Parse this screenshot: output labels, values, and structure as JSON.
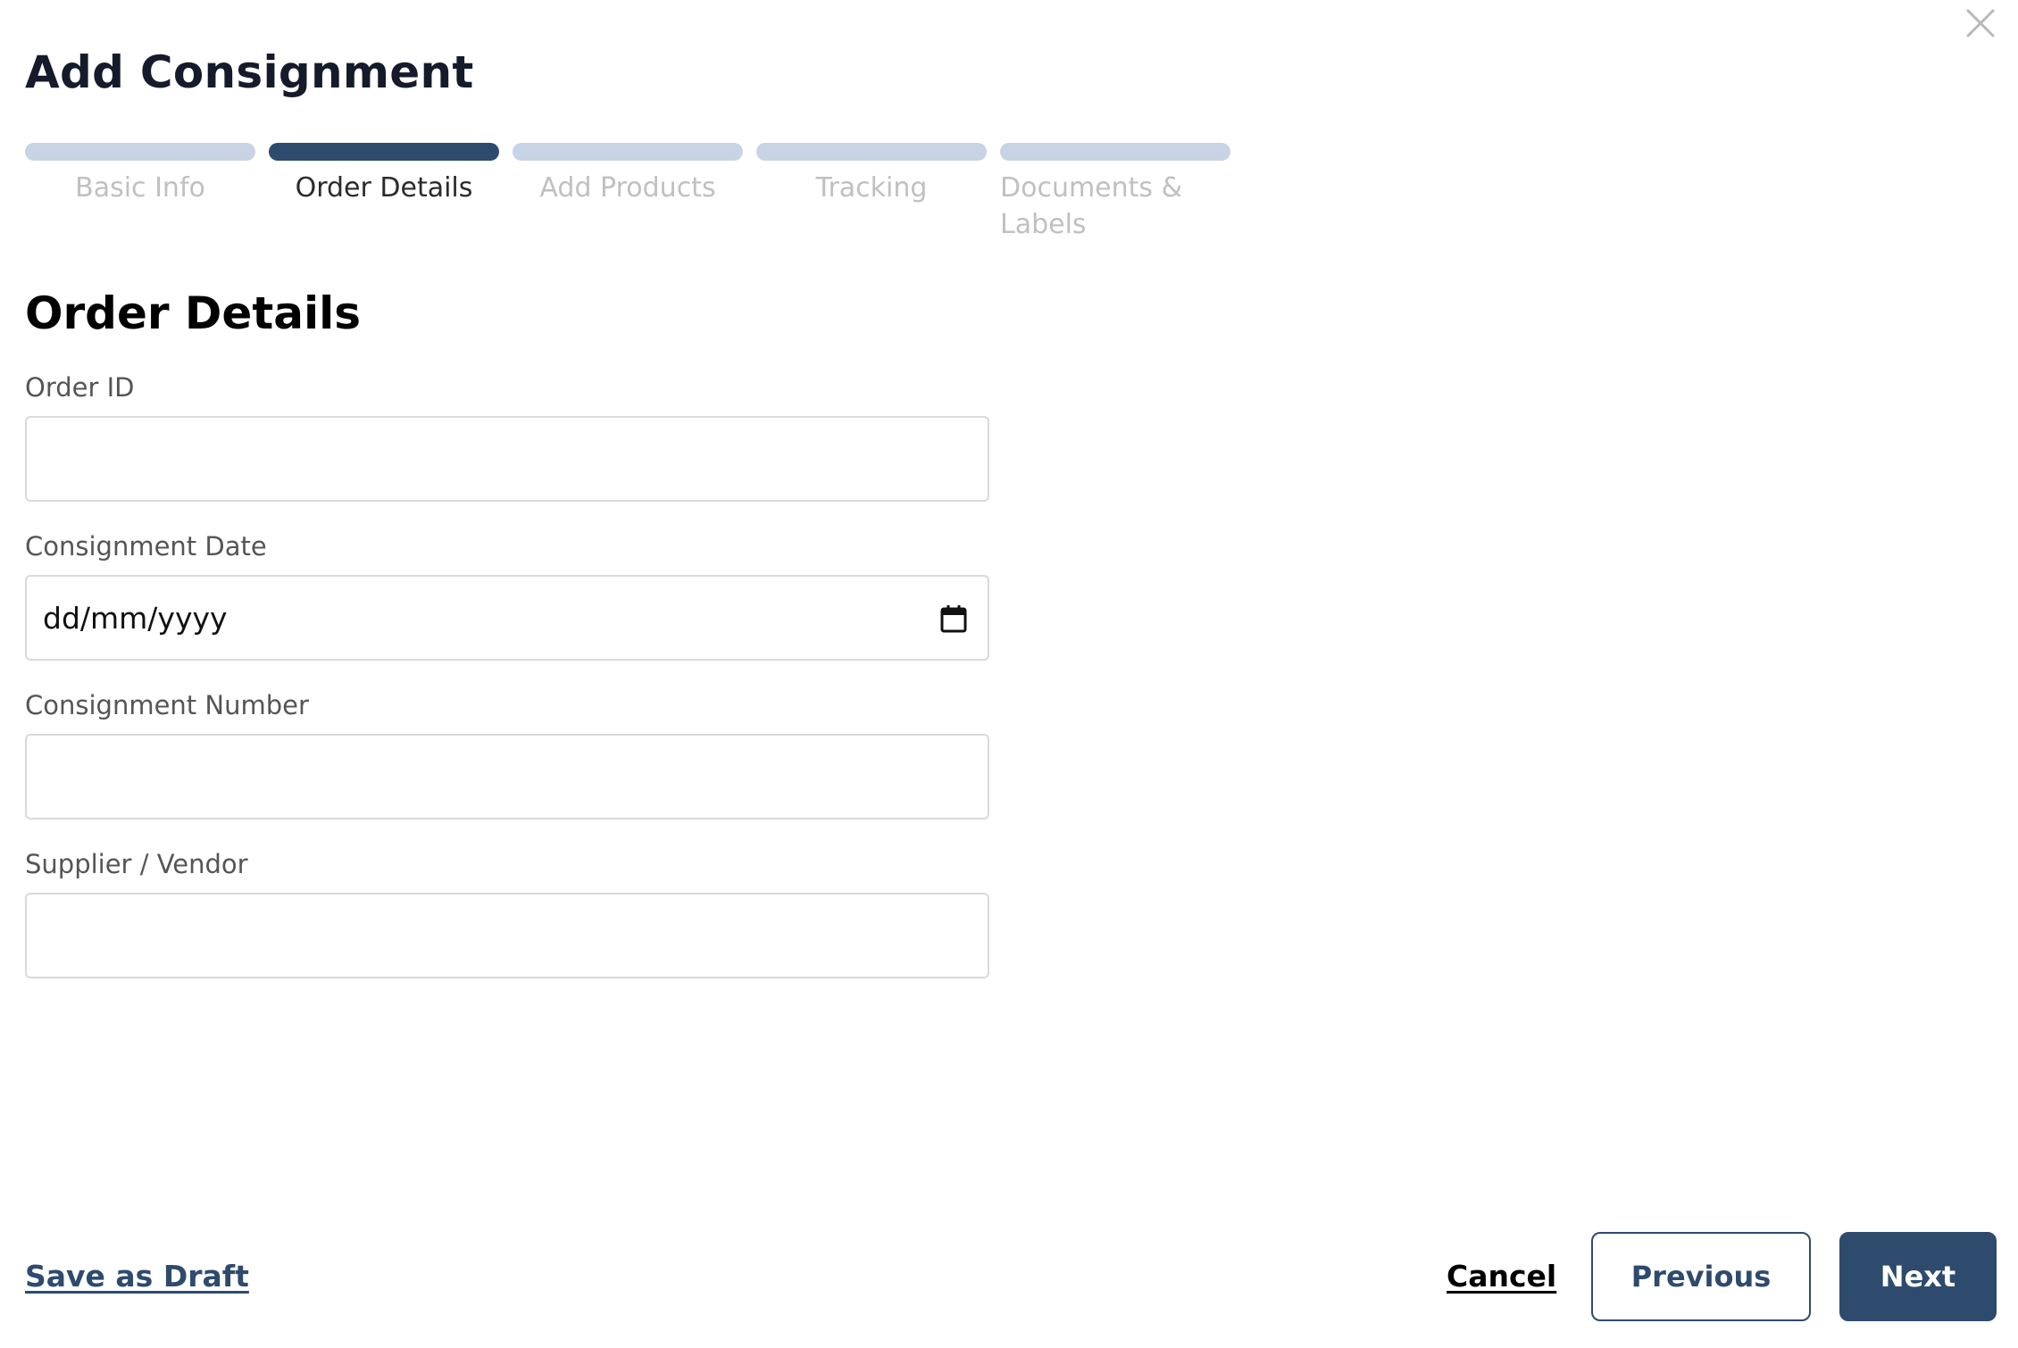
{
  "dialog": {
    "title": "Add Consignment"
  },
  "stepper": {
    "steps": [
      {
        "label": "Basic Info",
        "active": false
      },
      {
        "label": "Order Details",
        "active": true
      },
      {
        "label": "Add Products",
        "active": false
      },
      {
        "label": "Tracking",
        "active": false
      },
      {
        "label": "Documents & Labels",
        "active": false
      }
    ]
  },
  "section": {
    "title": "Order Details"
  },
  "form": {
    "order_id": {
      "label": "Order ID",
      "value": ""
    },
    "consignment_date": {
      "label": "Consignment Date",
      "value": "dd/mm/yyyy"
    },
    "consignment_number": {
      "label": "Consignment Number",
      "value": ""
    },
    "supplier_vendor": {
      "label": "Supplier / Vendor",
      "value": ""
    }
  },
  "footer": {
    "save_draft_label": "Save as Draft",
    "cancel_label": "Cancel",
    "previous_label": "Previous",
    "next_label": "Next"
  },
  "icons": {
    "close": "close-icon",
    "calendar": "calendar-icon"
  },
  "colors": {
    "primary": "#2e4b6e",
    "step_inactive": "#c9d3e6",
    "title": "#151b2b",
    "label": "#555555",
    "input_border": "#dadada"
  }
}
